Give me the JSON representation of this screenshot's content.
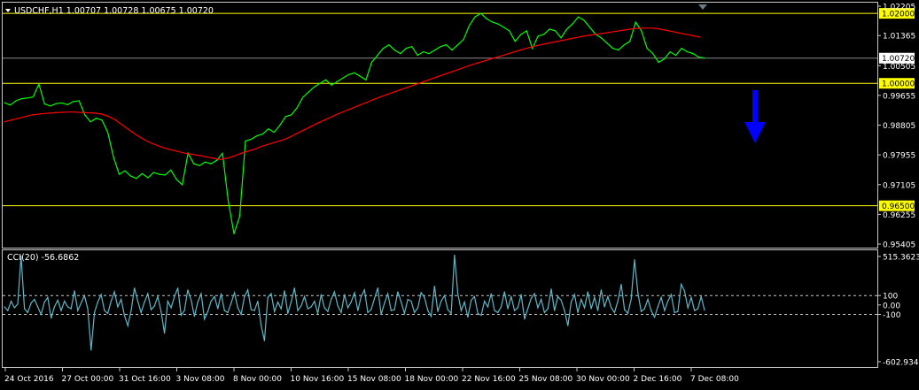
{
  "chart_data": [
    {
      "type": "line",
      "title": "USDCHF,H1  1.00707 1.00728 1.00675 1.00720",
      "ylim": [
        0.95405,
        1.02205
      ],
      "y_ticks": [
        "1.02205",
        "1.01365",
        "1.00505",
        "0.99655",
        "0.98805",
        "0.97955",
        "0.97105",
        "0.96255",
        "0.95405"
      ],
      "y_tick_values": [
        1.02205,
        1.01365,
        1.00505,
        0.99655,
        0.98805,
        0.97955,
        0.97105,
        0.96255,
        0.95405
      ],
      "horizontal_levels": [
        {
          "label": "1.02000",
          "value": 1.02
        },
        {
          "label": "1.00000",
          "value": 1.0
        },
        {
          "label": "0.96500",
          "value": 0.965
        }
      ],
      "current_price": {
        "label": "1.00720",
        "value": 1.0072
      },
      "series": [
        {
          "color": "#00ff00",
          "values": [
            0.9945,
            0.9938,
            0.995,
            0.9956,
            0.9958,
            0.9961,
            0.9998,
            0.9941,
            0.9935,
            0.9942,
            0.9944,
            0.9939,
            0.9948,
            0.995,
            0.991,
            0.989,
            0.99,
            0.9895,
            0.986,
            0.979,
            0.974,
            0.975,
            0.9735,
            0.9728,
            0.9742,
            0.973,
            0.9745,
            0.974,
            0.9738,
            0.9752,
            0.9725,
            0.971,
            0.98,
            0.977,
            0.9765,
            0.9775,
            0.977,
            0.978,
            0.98,
            0.9665,
            0.957,
            0.962,
            0.9835,
            0.984,
            0.985,
            0.9855,
            0.987,
            0.986,
            0.988,
            0.9905,
            0.991,
            0.993,
            0.996,
            0.9975,
            0.999,
            1.0,
            1.001,
            0.9995,
            1.0005,
            1.0015,
            1.0025,
            1.003,
            1.002,
            1.001,
            1.006,
            1.008,
            1.01,
            1.011,
            1.0095,
            1.0085,
            1.01,
            1.0105,
            1.008,
            1.009,
            1.0085,
            1.0095,
            1.0105,
            1.011,
            1.0095,
            1.011,
            1.0125,
            1.0165,
            1.019,
            1.02,
            1.0185,
            1.0175,
            1.017,
            1.016,
            1.015,
            1.012,
            1.014,
            1.015,
            1.01,
            1.0135,
            1.014,
            1.0155,
            1.015,
            1.013,
            1.0155,
            1.017,
            1.019,
            1.018,
            1.016,
            1.014,
            1.013,
            1.0115,
            1.01,
            1.0095,
            1.011,
            1.012,
            1.0175,
            1.015,
            1.01,
            1.0085,
            1.006,
            1.007,
            1.009,
            1.008,
            1.01,
            1.009,
            1.0085,
            1.0075,
            1.0072
          ]
        },
        {
          "color": "#ff0000",
          "values": [
            0.989,
            0.9895,
            0.99,
            0.9905,
            0.991,
            0.9912,
            0.9914,
            0.9916,
            0.9917,
            0.9918,
            0.9918,
            0.9917,
            0.9916,
            0.9915,
            0.9912,
            0.9905,
            0.9895,
            0.988,
            0.9866,
            0.9852,
            0.984,
            0.983,
            0.9822,
            0.9815,
            0.981,
            0.9805,
            0.98,
            0.9797,
            0.9794,
            0.979,
            0.9786,
            0.9782,
            0.9786,
            0.9792,
            0.98,
            0.9806,
            0.9812,
            0.982,
            0.9826,
            0.9832,
            0.9838,
            0.9846,
            0.9856,
            0.9866,
            0.9876,
            0.9886,
            0.9895,
            0.9904,
            0.9913,
            0.9921,
            0.9929,
            0.9937,
            0.9945,
            0.9953,
            0.9961,
            0.9968,
            0.9975,
            0.9982,
            0.9989,
            0.9996,
            1.0003,
            1.001,
            1.0017,
            1.0024,
            1.0031,
            1.0038,
            1.0045,
            1.0052,
            1.0058,
            1.0064,
            1.007,
            1.0076,
            1.0082,
            1.0088,
            1.0094,
            1.01,
            1.0105,
            1.011,
            1.0114,
            1.0118,
            1.0122,
            1.0126,
            1.013,
            1.0134,
            1.0137,
            1.014,
            1.0143,
            1.0146,
            1.0149,
            1.0152,
            1.0155,
            1.0157,
            1.0158,
            1.0158,
            1.0156,
            1.0152,
            1.0148,
            1.0144,
            1.014,
            1.0136,
            1.0132
          ]
        }
      ],
      "annotation": {
        "type": "down-arrow",
        "color": "#0000ff"
      }
    },
    {
      "type": "line",
      "title": "CCI(20) -56.6862",
      "ylim": [
        -602.9342,
        515.3623
      ],
      "y_ticks": [
        "515.3623",
        "100",
        "0.00",
        "-100",
        "-602.9342"
      ],
      "y_tick_values": [
        515.3623,
        100,
        0,
        -100,
        -602.9342
      ],
      "dashed_levels": [
        100,
        -100
      ],
      "series": [
        {
          "color": "#5fb8c8",
          "values": [
            -20,
            -60,
            40,
            -30,
            10,
            520,
            -40,
            -80,
            20,
            60,
            -20,
            -100,
            30,
            80,
            -140,
            -20,
            50,
            -60,
            40,
            -20,
            -40,
            150,
            -60,
            20,
            100,
            -40,
            -480,
            -80,
            30,
            110,
            -60,
            -90,
            40,
            140,
            -20,
            60,
            -110,
            -220,
            -60,
            180,
            40,
            -80,
            30,
            120,
            -50,
            -10,
            90,
            -70,
            -300,
            40,
            -30,
            90,
            180,
            -110,
            -60,
            160,
            50,
            -120,
            30,
            120,
            -150,
            -70,
            40,
            90,
            -40,
            120,
            -60,
            -80,
            20,
            130,
            -30,
            -100,
            90,
            160,
            -50,
            -60,
            40,
            -220,
            -380,
            80,
            120,
            -70,
            30,
            -40,
            150,
            -90,
            30,
            180,
            -60,
            -10,
            90,
            -40,
            -20,
            40,
            -90,
            110,
            -30,
            -70,
            60,
            140,
            -10,
            -80,
            110,
            -30,
            30,
            130,
            -60,
            90,
            160,
            -80,
            -50,
            70,
            180,
            -100,
            20,
            120,
            -60,
            -50,
            140,
            30,
            -90,
            60,
            40,
            -80,
            -30,
            130,
            80,
            -60,
            -120,
            200,
            -70,
            40,
            100,
            -50,
            -90,
            530,
            120,
            -60,
            30,
            -130,
            50,
            90,
            -90,
            -110,
            40,
            -20,
            120,
            -60,
            -80,
            -20,
            140,
            -40,
            90,
            -60,
            -30,
            110,
            -150,
            -40,
            70,
            120,
            -30,
            60,
            -80,
            -40,
            170,
            -60,
            90,
            50,
            -60,
            -220,
            30,
            110,
            -80,
            60,
            -30,
            140,
            -40,
            80,
            -60,
            160,
            -20,
            90,
            -30,
            -80,
            40,
            220,
            -50,
            -90,
            60,
            480,
            130,
            -70,
            -40,
            60,
            -60,
            -130,
            -20,
            80,
            -60,
            40,
            110,
            -80,
            -70,
            220,
            150,
            -30,
            80,
            -60,
            -40,
            90,
            -57
          ]
        }
      ]
    }
  ],
  "x_axis_labels": [
    "24 Oct 2016",
    "27 Oct 00:00",
    "31 Oct 16:00",
    "3 Nov 08:00",
    "8 Nov 00:00",
    "10 Nov 16:00",
    "15 Nov 08:00",
    "18 Nov 00:00",
    "22 Nov 16:00",
    "25 Nov 08:00",
    "30 Nov 00:00",
    "2 Dec 16:00",
    "7 Dec 08:00"
  ],
  "colors": {
    "background": "#000000",
    "grid_frame": "#c8c8c8",
    "level_line": "#ffff00",
    "price_line": "#00ff00",
    "ma_line": "#ff0000",
    "cci_line": "#5fb8c8"
  }
}
